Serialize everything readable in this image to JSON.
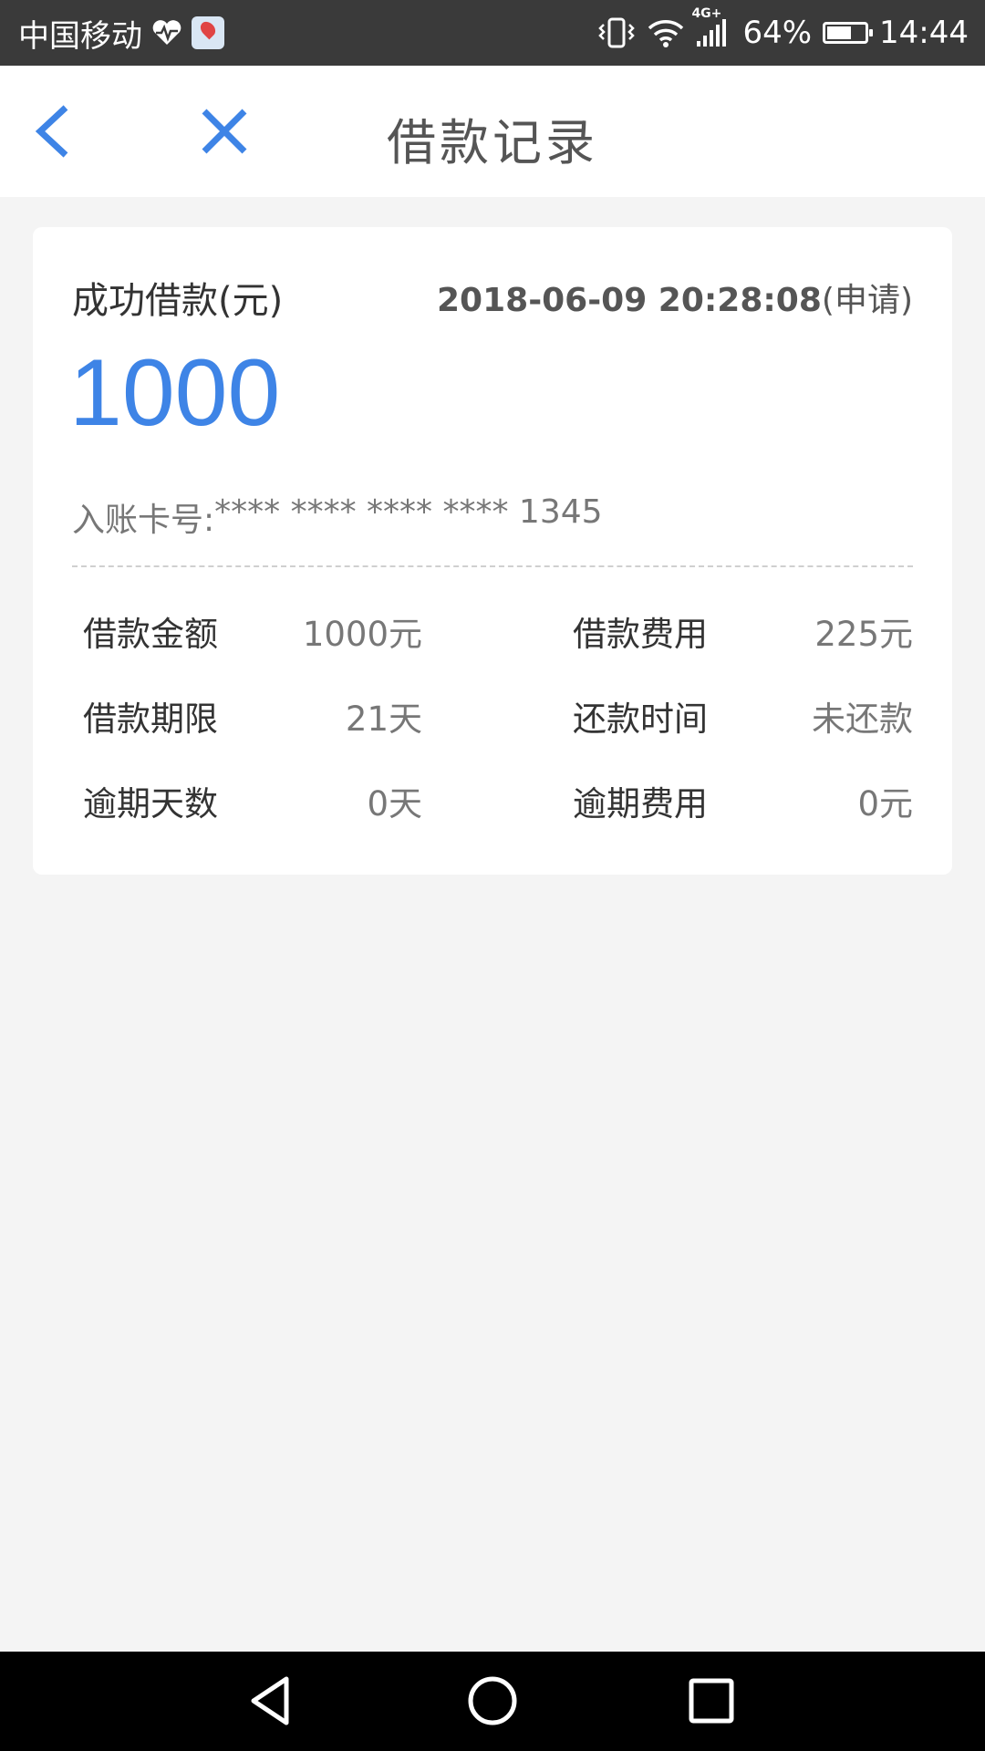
{
  "status_bar": {
    "carrier": "中国移动",
    "network_badge": "4G+",
    "battery_percent": "64%",
    "battery_level": 0.64,
    "time": "14:44",
    "icons": [
      "heart-rate-icon",
      "map-app-icon",
      "vibrate-icon",
      "wifi-icon",
      "signal-icon",
      "battery-icon"
    ]
  },
  "nav": {
    "title": "借款记录",
    "back_icon": "chevron-left-icon",
    "close_icon": "close-icon",
    "accent_color": "#3e84e6"
  },
  "loan": {
    "status_label": "成功借款(元)",
    "datetime": "2018-06-09 20:28:08",
    "datetime_suffix": "(申请)",
    "amount": "1000",
    "account_label": "入账卡号:",
    "account_number": "**** **** **** **** 1345",
    "details": [
      [
        {
          "label": "借款金额",
          "value": "1000元"
        },
        {
          "label": "借款费用",
          "value": "225元"
        }
      ],
      [
        {
          "label": "借款期限",
          "value": "21天"
        },
        {
          "label": "还款时间",
          "value": "未还款"
        }
      ],
      [
        {
          "label": "逾期天数",
          "value": "0天"
        },
        {
          "label": "逾期费用",
          "value": "0元"
        }
      ]
    ]
  },
  "system_nav": {
    "icons": [
      "back-triangle-icon",
      "home-circle-icon",
      "recents-square-icon"
    ]
  }
}
